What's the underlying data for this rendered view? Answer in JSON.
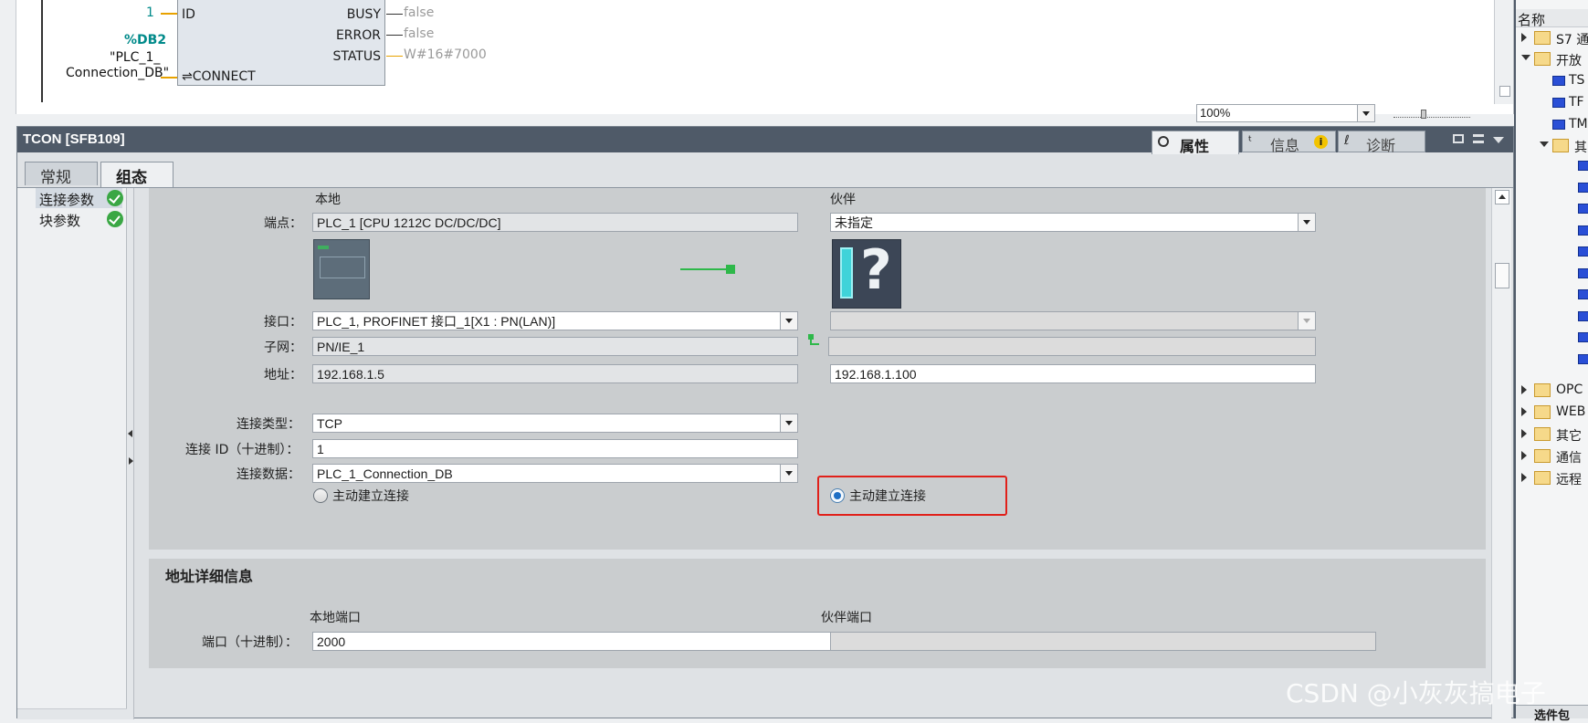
{
  "block": {
    "id_value": "1",
    "id_label": "ID",
    "db_ref": "%DB2",
    "db_name_line1": "\"PLC_1_",
    "db_name_line2": "Connection_DB\"",
    "connect_label": "⇌CONNECT",
    "busy_label": "BUSY",
    "busy_value": "false",
    "error_label": "ERROR",
    "error_value": "false",
    "status_label": "STATUS",
    "status_value": "W#16#7000"
  },
  "zoom": {
    "value": "100%"
  },
  "inspector": {
    "title": "TCON [SFB109]",
    "tabs": {
      "properties": "属性",
      "info": "信息",
      "diagnostics": "诊断"
    },
    "subtabs": {
      "general": "常规",
      "config": "组态"
    },
    "nav": [
      {
        "label": "连接参数",
        "status": "ok"
      },
      {
        "label": "块参数",
        "status": "ok"
      }
    ]
  },
  "connection": {
    "local_header": "本地",
    "partner_header": "伙伴",
    "endpoint_label": "端点：",
    "local_endpoint": "PLC_1 [CPU 1212C DC/DC/DC]",
    "partner_endpoint": "未指定",
    "interface_label": "接口：",
    "local_interface": "PLC_1, PROFINET 接口_1[X1 : PN(LAN)]",
    "partner_interface": "",
    "subnet_label": "子网：",
    "local_subnet": "PN/IE_1",
    "partner_subnet": "",
    "address_label": "地址：",
    "local_address": "192.168.1.5",
    "partner_address": "192.168.1.100",
    "conn_type_label": "连接类型：",
    "conn_type": "TCP",
    "conn_id_label": "连接 ID（十进制）：",
    "conn_id": "1",
    "conn_data_label": "连接数据：",
    "conn_data": "PLC_1_Connection_DB",
    "local_active_label": "主动建立连接",
    "local_active_checked": false,
    "partner_active_label": "主动建立连接",
    "partner_active_checked": true,
    "highlight_color": "#e0201a"
  },
  "address_details": {
    "title": "地址详细信息",
    "local_port_header": "本地端口",
    "partner_port_header": "伙伴端口",
    "port_label": "端口（十进制）：",
    "local_port": "2000",
    "partner_port": ""
  },
  "tree": {
    "header": "名称",
    "items": [
      {
        "label": "S7 通",
        "type": "folder",
        "expanded": false
      },
      {
        "label": "开放",
        "type": "folder",
        "expanded": true
      },
      {
        "label": "TS",
        "type": "block"
      },
      {
        "label": "TF",
        "type": "block"
      },
      {
        "label": "TM",
        "type": "block"
      },
      {
        "label": "其",
        "type": "folder",
        "expanded": true
      },
      {
        "label": "OPC",
        "type": "folder",
        "expanded": false
      },
      {
        "label": "WEB",
        "type": "folder",
        "expanded": false
      },
      {
        "label": "其它",
        "type": "folder",
        "expanded": false
      },
      {
        "label": "通信",
        "type": "folder",
        "expanded": false
      },
      {
        "label": "远程",
        "type": "folder",
        "expanded": false
      }
    ],
    "bottom_label": "选件包"
  },
  "watermark": "CSDN @小灰灰搞电子",
  "colors": {
    "accent_teal": "#008a8a",
    "title_bar": "#4f5a68",
    "ok_green": "#3aa744",
    "signal_orange": "#e8a200"
  }
}
